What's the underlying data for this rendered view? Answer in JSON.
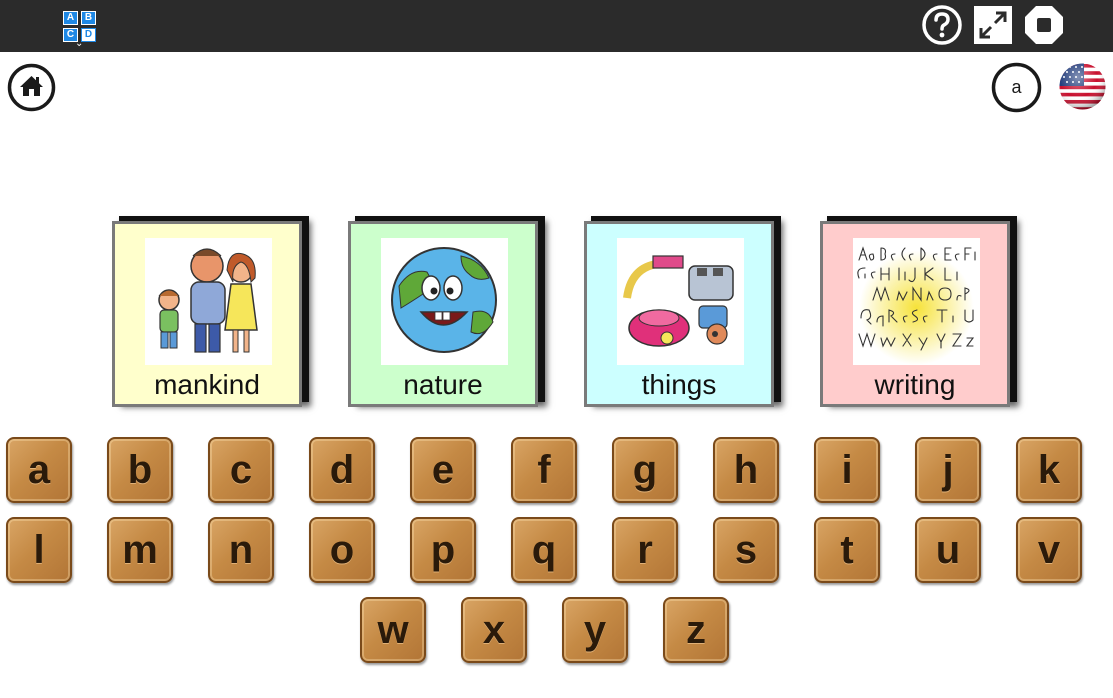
{
  "logo": {
    "tl": "A",
    "tr": "B",
    "bl": "C",
    "br": "D"
  },
  "toolbar": {
    "help_icon": "question-circle-icon",
    "fullscreen_icon": "expand-icon",
    "stop_icon": "stop-octagon-icon"
  },
  "home": {
    "icon": "home-icon"
  },
  "letter_case": {
    "label": "a"
  },
  "language": {
    "icon": "us-flag-icon"
  },
  "categories": [
    {
      "label": "mankind",
      "bg": "#ffffcc"
    },
    {
      "label": "nature",
      "bg": "#ccffcc"
    },
    {
      "label": "things",
      "bg": "#ccffff"
    },
    {
      "label": "writing",
      "bg": "#ffcccc"
    }
  ],
  "letters": [
    "a",
    "b",
    "c",
    "d",
    "e",
    "f",
    "g",
    "h",
    "i",
    "j",
    "k",
    "l",
    "m",
    "n",
    "o",
    "p",
    "q",
    "r",
    "s",
    "t",
    "u",
    "v",
    "w",
    "x",
    "y",
    "z"
  ]
}
